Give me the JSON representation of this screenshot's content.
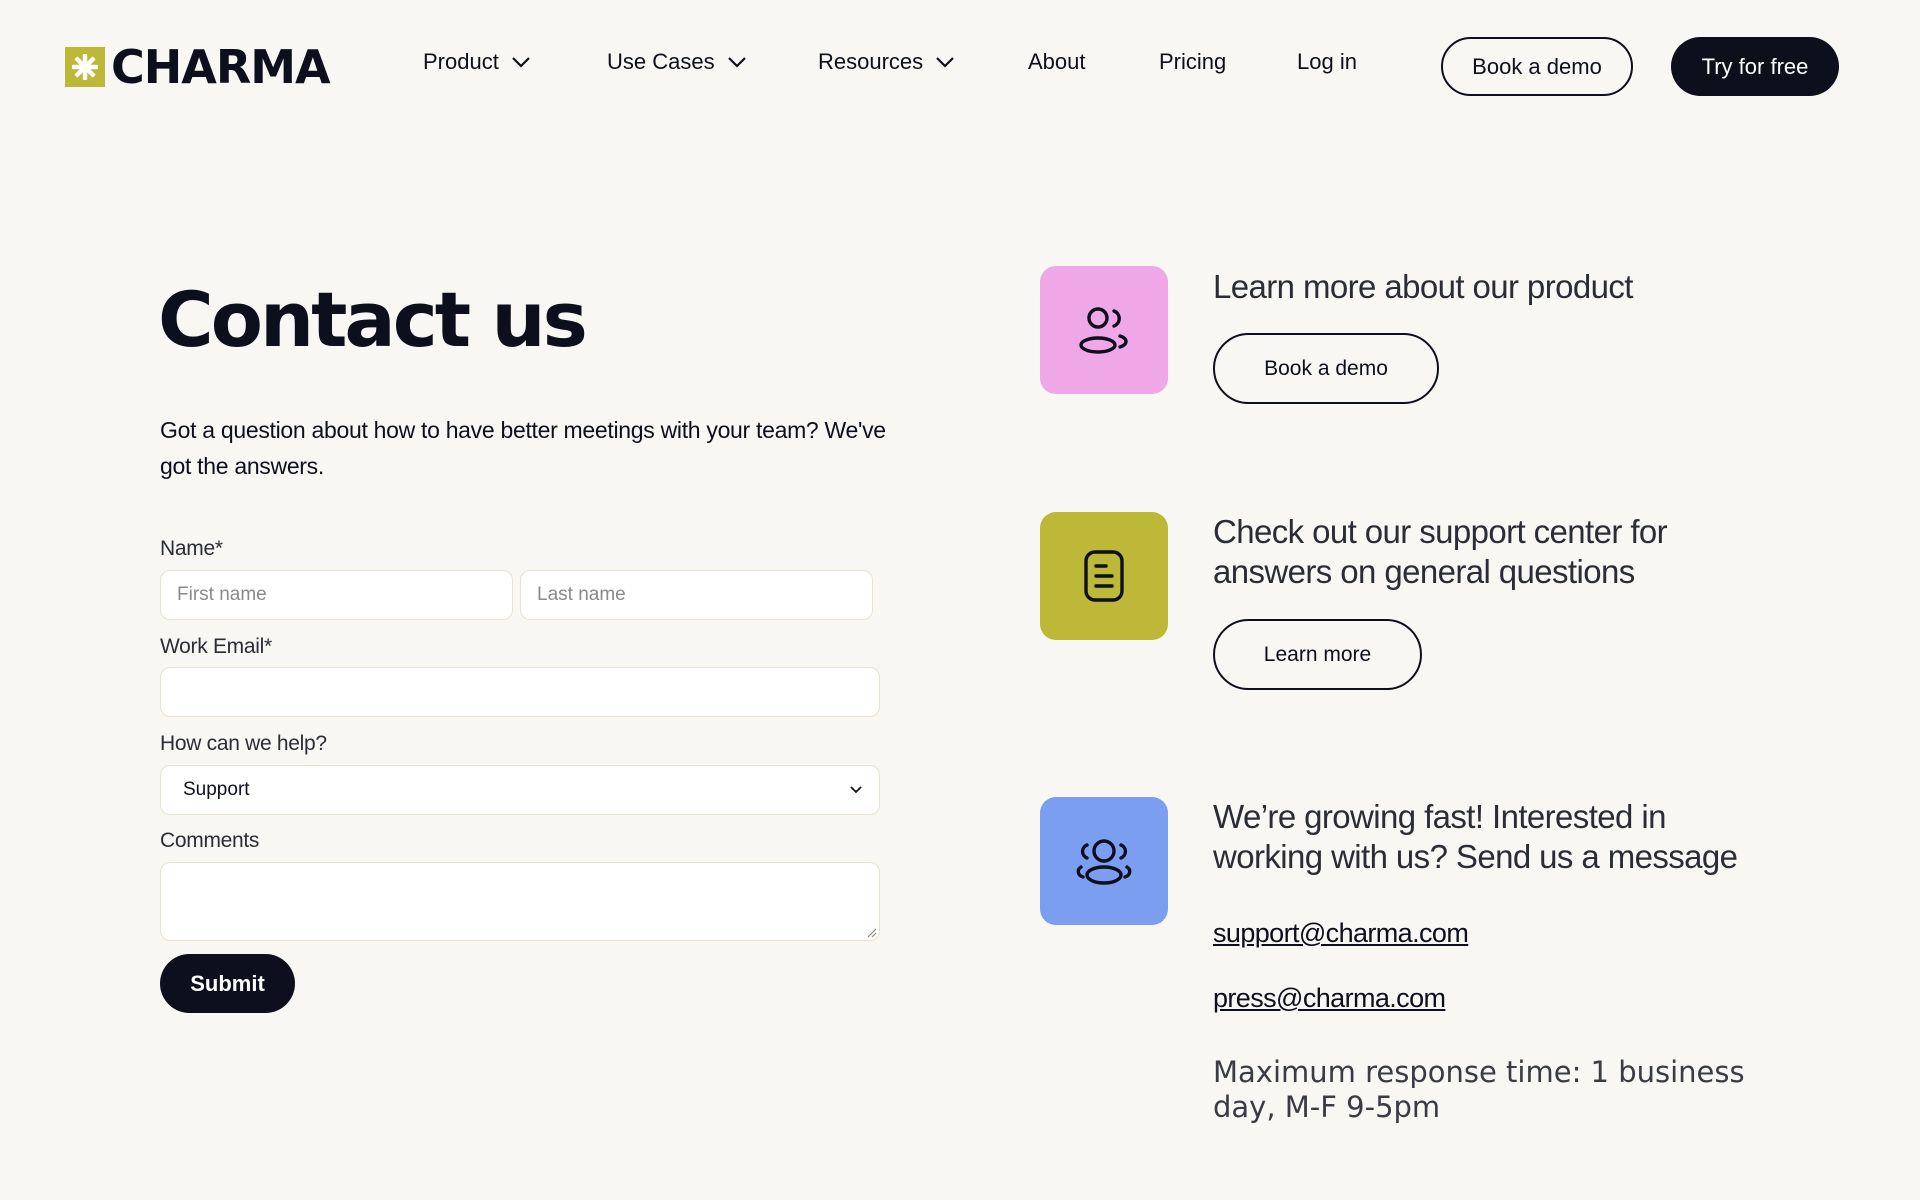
{
  "brand": {
    "name": "CHARMA",
    "accent": "#bdb838"
  },
  "nav": {
    "items": [
      {
        "label": "Product",
        "has_dropdown": true
      },
      {
        "label": "Use Cases",
        "has_dropdown": true
      },
      {
        "label": "Resources",
        "has_dropdown": true
      },
      {
        "label": "About",
        "has_dropdown": false
      },
      {
        "label": "Pricing",
        "has_dropdown": false
      },
      {
        "label": "Log in",
        "has_dropdown": false
      }
    ],
    "book_demo": "Book a demo",
    "try_free": "Try for free"
  },
  "contact": {
    "title": "Contact us",
    "intro": "Got a question about how to have better meetings with your team? We've got the answers.",
    "form": {
      "name_label": "Name*",
      "first_name_placeholder": "First name",
      "last_name_placeholder": "Last name",
      "email_label": "Work Email*",
      "email_value": "",
      "help_label": "How can we help?",
      "help_selected": "Support",
      "comments_label": "Comments",
      "comments_value": "",
      "submit_label": "Submit"
    }
  },
  "cards": [
    {
      "icon": "users-icon",
      "color": "#f0a7e8",
      "heading": "Learn more about our product",
      "button": "Book a demo"
    },
    {
      "icon": "document-icon",
      "color": "#bdb838",
      "heading": "Check out our support center for answers on general questions",
      "button": "Learn more"
    },
    {
      "icon": "team-icon",
      "color": "#7b9ef0",
      "heading": "We’re growing fast! Interested in working with us? Send us a message"
    }
  ],
  "emails": [
    "support@charma.com",
    "press@charma.com"
  ],
  "response_time": "Maximum response time: 1 business day, M-F 9-5pm"
}
